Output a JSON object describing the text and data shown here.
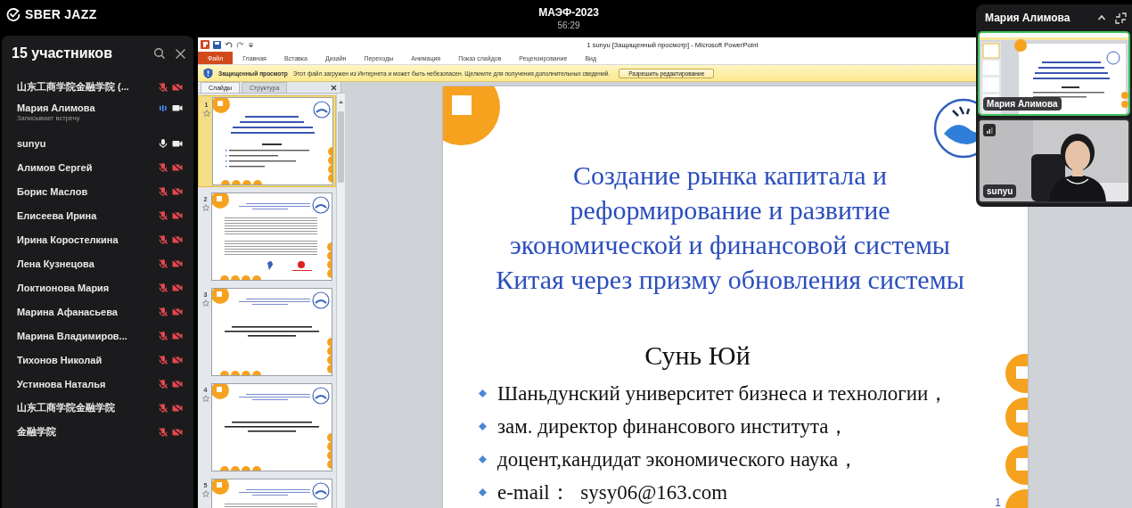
{
  "app": {
    "brand": "SBER JAZZ",
    "meeting_title": "МАЭФ-2023",
    "timer": "56:29"
  },
  "participants_panel": {
    "heading": "15 участников",
    "participants": [
      {
        "name": "山东工商学院金融学院 (...",
        "mic_muted": true,
        "speaking": false,
        "camera_on": false
      },
      {
        "name": "Мария Алимова",
        "status": "Записывает встречу",
        "mic_muted": false,
        "speaking": true,
        "camera_on": true
      },
      {
        "name": "sunyu",
        "mic_muted": false,
        "speaking": false,
        "camera_on": true
      },
      {
        "name": "Алимов Сергей",
        "mic_muted": true,
        "speaking": false,
        "camera_on": false
      },
      {
        "name": "Борис Маслов",
        "mic_muted": true,
        "speaking": false,
        "camera_on": false
      },
      {
        "name": "Елисеева Ирина",
        "mic_muted": true,
        "speaking": false,
        "camera_on": false
      },
      {
        "name": "Ирина Коростелкина",
        "mic_muted": true,
        "speaking": false,
        "camera_on": false
      },
      {
        "name": "Лена Кузнецова",
        "mic_muted": true,
        "speaking": false,
        "camera_on": false
      },
      {
        "name": "Локтионова Мария",
        "mic_muted": true,
        "speaking": false,
        "camera_on": false
      },
      {
        "name": "Марина Афанасьева",
        "mic_muted": true,
        "speaking": false,
        "camera_on": false
      },
      {
        "name": "Марина Владимиров...",
        "mic_muted": true,
        "speaking": false,
        "camera_on": false
      },
      {
        "name": "Тихонов Николай",
        "mic_muted": true,
        "speaking": false,
        "camera_on": false
      },
      {
        "name": "Устинова Наталья",
        "mic_muted": true,
        "speaking": false,
        "camera_on": false
      },
      {
        "name": "山东工商学院金融学院",
        "mic_muted": true,
        "speaking": false,
        "camera_on": false
      },
      {
        "name": "金融学院",
        "mic_muted": true,
        "speaking": false,
        "camera_on": false
      }
    ]
  },
  "powerpoint": {
    "window_title": "1 sunyu [Защищенный просмотр] - Microsoft PowerPoint",
    "ribbon_tabs": [
      {
        "label": "Файл",
        "selected": true
      },
      {
        "label": "Главная",
        "selected": false
      },
      {
        "label": "Вставка",
        "selected": false
      },
      {
        "label": "Дизайн",
        "selected": false
      },
      {
        "label": "Переходы",
        "selected": false
      },
      {
        "label": "Анимация",
        "selected": false
      },
      {
        "label": "Показ слайдов",
        "selected": false
      },
      {
        "label": "Рецензирование",
        "selected": false
      },
      {
        "label": "Вид",
        "selected": false
      }
    ],
    "protected_bar": {
      "title": "Защищенный просмотр",
      "message": "Этот файл загружен из Интернета и может быть небезопасен. Щелкните для получения дополнительных сведений.",
      "button": "Разрешить редактирование"
    },
    "pane_tabs": [
      {
        "label": "Слайды",
        "selected": true
      },
      {
        "label": "Структура",
        "selected": false
      }
    ],
    "thumbnails": [
      {
        "number": "1",
        "kind": "title",
        "selected": true
      },
      {
        "number": "2",
        "kind": "text",
        "selected": false
      },
      {
        "number": "3",
        "kind": "statement",
        "selected": false
      },
      {
        "number": "4",
        "kind": "statement",
        "selected": false
      },
      {
        "number": "5",
        "kind": "text",
        "selected": false
      }
    ],
    "slide": {
      "title": "Создание рынка капитала и\nреформирование и развитие\nэкономической и финансовой системы\nКитая через призму обновления системы",
      "author": "Сунь Юй",
      "bullets": [
        "Шаньдунский университет бизнеса и технологии，",
        "зам. директор финансового института，",
        "доцент,кандидат экономического наука，",
        "e-mail：  sysy06@163.com"
      ],
      "page_number": "1"
    }
  },
  "video_panel": {
    "title": "Мария Алимова",
    "tiles": [
      {
        "label": "Мария Алимова",
        "kind": "screen",
        "speaking": true
      },
      {
        "label": "sunyu",
        "kind": "camera",
        "speaking": false
      }
    ]
  }
}
